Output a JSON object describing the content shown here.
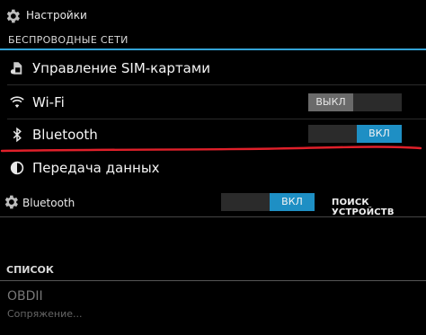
{
  "topbar": {
    "title": "Настройки"
  },
  "section": {
    "title": "БЕСПРОВОДНЫЕ СЕТИ"
  },
  "rows": [
    {
      "label": "Управление SIM-картами",
      "icon": "sim-card-icon"
    },
    {
      "label": "Wi-Fi",
      "icon": "wifi-icon",
      "toggle": {
        "state": "off",
        "label": "ВЫКЛ"
      }
    },
    {
      "label": "Bluetooth",
      "icon": "bluetooth-icon",
      "toggle": {
        "state": "on",
        "label": "ВКЛ"
      }
    },
    {
      "label": "Передача данных",
      "icon": "data-usage-icon"
    }
  ],
  "bluetooth_panel": {
    "title": "Bluetooth",
    "toggle": {
      "state": "on",
      "label": "ВКЛ"
    },
    "search_label": "ПОИСК УСТРОЙСТВ"
  },
  "list": {
    "header": "СПИСОК",
    "devices": [
      {
        "name": "OBDII",
        "status": "Сопряжение..."
      }
    ]
  },
  "colors": {
    "accent": "#33a3d6",
    "toggle_on": "#1e8fc4",
    "toggle_off": "#6a6a6a",
    "annotation": "#e0202a"
  }
}
